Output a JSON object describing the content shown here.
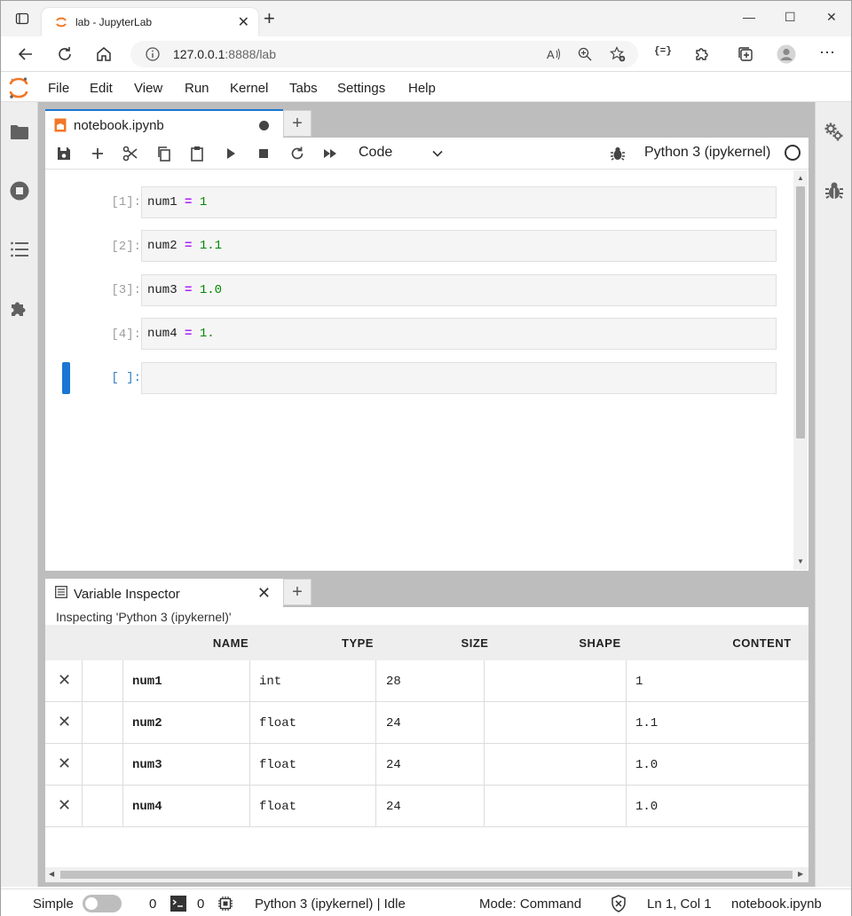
{
  "browser": {
    "tab_title": "lab - JupyterLab",
    "url_host": "127.0.0.1",
    "url_rest": ":8888/lab",
    "new_tab": "+",
    "close_tab": "✕",
    "minimize": "—",
    "maximize": "☐",
    "close_window": "✕",
    "extensions_label": "{=}"
  },
  "menubar": {
    "items": [
      "File",
      "Edit",
      "View",
      "Run",
      "Kernel",
      "Tabs",
      "Settings",
      "Help"
    ]
  },
  "notebook": {
    "tab_label": "notebook.ipynb",
    "add_tab": "+",
    "cell_type": "Code",
    "kernel": "Python 3 (ipykernel)",
    "cells": [
      {
        "prompt": "[1]:",
        "var": "num1",
        "eq": "=",
        "value": "1"
      },
      {
        "prompt": "[2]:",
        "var": "num2",
        "eq": "=",
        "value": "1.1"
      },
      {
        "prompt": "[3]:",
        "var": "num3",
        "eq": "=",
        "value": "1.0"
      },
      {
        "prompt": "[4]:",
        "var": "num4",
        "eq": "=",
        "value": "1."
      }
    ],
    "empty_prompt": "[ ]:"
  },
  "inspector": {
    "tab_label": "Variable Inspector",
    "close": "✕",
    "add_tab": "+",
    "status": "Inspecting 'Python 3 (ipykernel)'",
    "columns": [
      "NAME",
      "TYPE",
      "SIZE",
      "SHAPE",
      "CONTENT"
    ],
    "delete_glyph": "✕",
    "rows": [
      {
        "name": "num1",
        "type": "int",
        "size": "28",
        "shape": "",
        "content": "1"
      },
      {
        "name": "num2",
        "type": "float",
        "size": "24",
        "shape": "",
        "content": "1.1"
      },
      {
        "name": "num3",
        "type": "float",
        "size": "24",
        "shape": "",
        "content": "1.0"
      },
      {
        "name": "num4",
        "type": "float",
        "size": "24",
        "shape": "",
        "content": "1.0"
      }
    ]
  },
  "statusbar": {
    "simple_label": "Simple",
    "terminals_count": "0",
    "kernels_count": "0",
    "kernel_status": "Python 3 (ipykernel) | Idle",
    "mode": "Mode: Command",
    "position": "Ln 1, Col 1",
    "filename": "notebook.ipynb"
  },
  "colors": {
    "accent": "#1976d2",
    "jupyter_orange": "#f37726",
    "code_operator": "#aa22ff",
    "code_number": "#008800"
  }
}
